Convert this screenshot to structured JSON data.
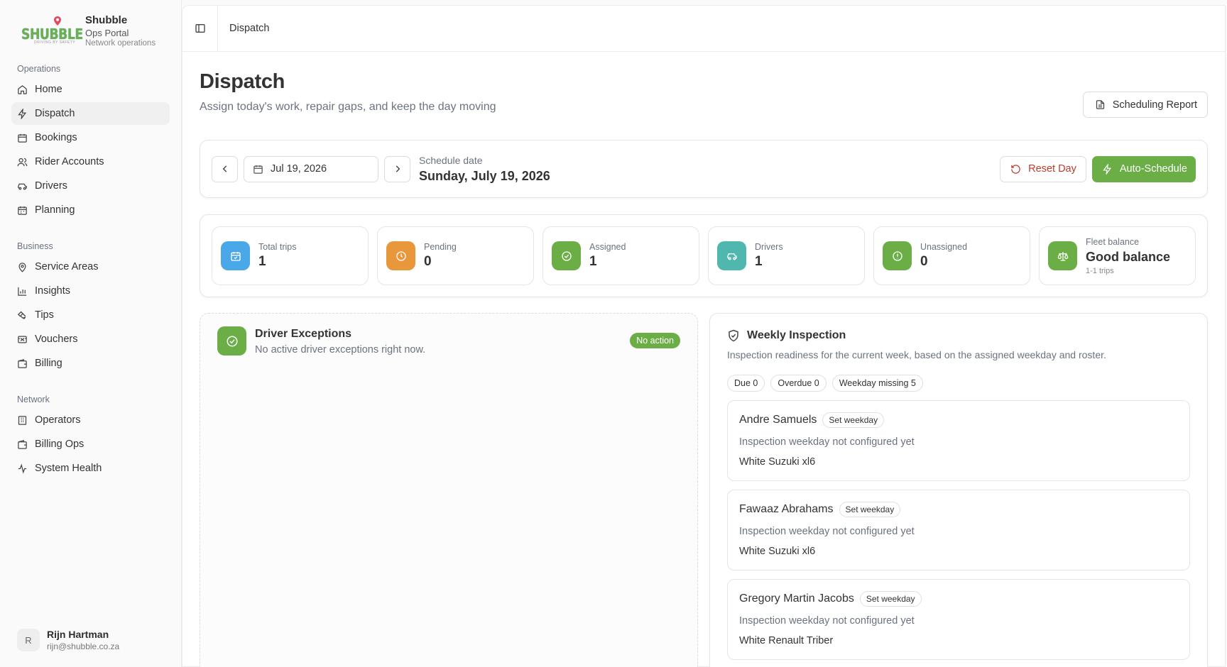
{
  "brand": {
    "logo_text": "SHUBBLE",
    "logo_tagline": "DRIVING BY SAFETY",
    "name": "Shubble",
    "portal": "Ops Portal",
    "subtitle": "Network operations"
  },
  "sidebar": {
    "groups": [
      {
        "title": "Operations",
        "items": [
          {
            "label": "Home",
            "icon": "home-icon"
          },
          {
            "label": "Dispatch",
            "icon": "zap-icon",
            "active": true
          },
          {
            "label": "Bookings",
            "icon": "calendar-icon"
          },
          {
            "label": "Rider Accounts",
            "icon": "users-icon"
          },
          {
            "label": "Drivers",
            "icon": "car-icon"
          },
          {
            "label": "Planning",
            "icon": "calendar-days-icon"
          }
        ]
      },
      {
        "title": "Business",
        "items": [
          {
            "label": "Service Areas",
            "icon": "map-pin-icon"
          },
          {
            "label": "Insights",
            "icon": "bar-chart-icon"
          },
          {
            "label": "Tips",
            "icon": "tip-icon"
          },
          {
            "label": "Vouchers",
            "icon": "ticket-icon"
          },
          {
            "label": "Billing",
            "icon": "wallet-icon"
          }
        ]
      },
      {
        "title": "Network",
        "items": [
          {
            "label": "Operators",
            "icon": "building-icon"
          },
          {
            "label": "Billing Ops",
            "icon": "wallet-icon"
          },
          {
            "label": "System Health",
            "icon": "activity-icon"
          }
        ]
      }
    ]
  },
  "user": {
    "initial": "R",
    "name": "Rijn Hartman",
    "email": "rijn@shubble.co.za"
  },
  "topbar": {
    "breadcrumb": "Dispatch"
  },
  "page": {
    "title": "Dispatch",
    "subtitle": "Assign today's work, repair gaps, and keep the day moving",
    "report_button": "Scheduling Report"
  },
  "date_bar": {
    "date_value": "Jul 19, 2026",
    "schedule_label": "Schedule date",
    "schedule_value": "Sunday, July 19, 2026",
    "reset_label": "Reset Day",
    "auto_label": "Auto-Schedule"
  },
  "stats": [
    {
      "label": "Total trips",
      "value": "1",
      "color": "#4aa8e8",
      "icon": "calendar-check-icon"
    },
    {
      "label": "Pending",
      "value": "0",
      "color": "#e8973a",
      "icon": "clock-icon"
    },
    {
      "label": "Assigned",
      "value": "1",
      "color": "#6aae45",
      "icon": "check-circle-icon"
    },
    {
      "label": "Drivers",
      "value": "1",
      "color": "#4fb7ad",
      "icon": "car-icon"
    },
    {
      "label": "Unassigned",
      "value": "0",
      "color": "#6aae45",
      "icon": "alert-circle-icon"
    },
    {
      "label": "Fleet balance",
      "value": "Good balance",
      "sub": "1-1 trips",
      "color": "#6aae45",
      "icon": "scale-icon"
    }
  ],
  "exceptions": {
    "title": "Driver Exceptions",
    "subtitle": "No active driver exceptions right now.",
    "badge": "No action"
  },
  "inspection": {
    "title": "Weekly Inspection",
    "subtitle": "Inspection readiness for the current week, based on the assigned weekday and roster.",
    "chips": [
      "Due 0",
      "Overdue 0",
      "Weekday missing 5"
    ],
    "drivers": [
      {
        "name": "Andre Samuels",
        "chip": "Set weekday",
        "note": "Inspection weekday not configured yet",
        "vehicle": "White Suzuki xl6"
      },
      {
        "name": "Fawaaz Abrahams",
        "chip": "Set weekday",
        "note": "Inspection weekday not configured yet",
        "vehicle": "White Suzuki xl6"
      },
      {
        "name": "Gregory Martin Jacobs",
        "chip": "Set weekday",
        "note": "Inspection weekday not configured yet",
        "vehicle": "White Renault Triber"
      }
    ]
  },
  "colors": {
    "accent_green": "#6aae45",
    "danger": "#c0392b"
  }
}
